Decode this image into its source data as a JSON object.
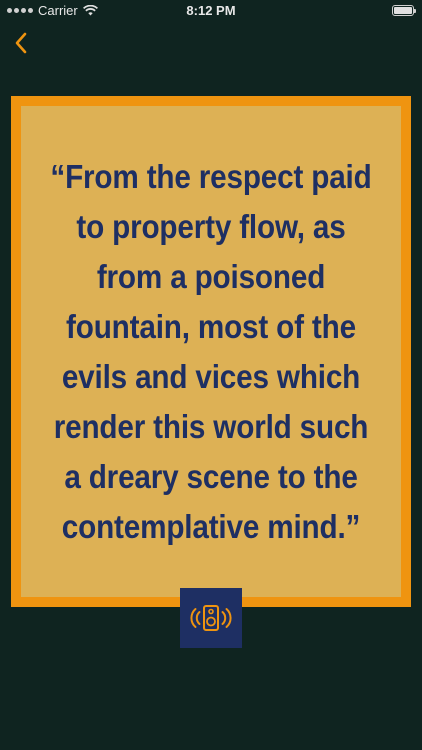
{
  "status_bar": {
    "carrier": "Carrier",
    "time": "8:12 PM",
    "battery_level": 1.0
  },
  "nav": {
    "back_icon": "chevron-left-icon"
  },
  "quote": {
    "text": "“From the respect paid to property flow, as from a poisoned fountain, most of the evils and vices which render this world such a dreary scene to the contemplative mind.”"
  },
  "audio": {
    "icon": "speaker-sound-icon"
  },
  "colors": {
    "background": "#0f2420",
    "accent": "#ef9410",
    "card": "#ddb155",
    "text": "#1e2f63"
  }
}
